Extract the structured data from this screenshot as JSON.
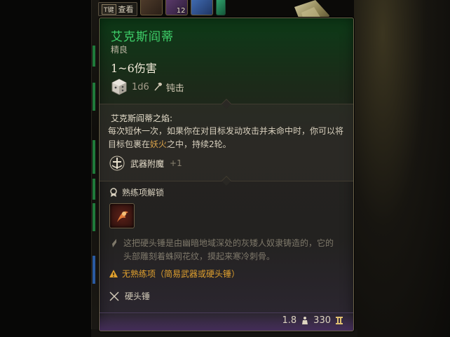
{
  "hotbar": {
    "key": "T键",
    "inspect_label": "查看",
    "slot_count": "12"
  },
  "item": {
    "name": "艾克斯阎蒂",
    "rarity": "精良",
    "damage": "1~6伤害",
    "dice": "1d6",
    "damage_type": "钝击",
    "ability_title": "艾克斯阎蒂之焰:",
    "ability_desc_part1": "每次短休一次，如果你在对目标发动攻击并未命中时，你可以将目标包裹在",
    "ability_desc_highlight": "妖火",
    "ability_desc_part2": "之中，持续2轮。",
    "enchant_label": "武器附魔",
    "enchant_value": "+1",
    "unlock_label": "熟练项解锁",
    "flavor_text": "这把硬头锤是由幽暗地域深处的灰矮人奴隶铸造的，它的头部雕刻着蛛网花纹，摸起来寒冷刺骨。",
    "warning": "无熟练项（简易武器或硬头锤）",
    "weapon_type": "硬头锤",
    "weight": "1.8",
    "value": "330"
  },
  "colors": {
    "name": "#3fd06a",
    "warning": "#e0a02e",
    "highlight": "#d9a24a"
  },
  "icons": {
    "dice": "d6-icon",
    "enchant": "weapon-enchant-icon",
    "unlock": "proficiency-unlock-icon",
    "flavor": "quill-icon",
    "warning": "warning-icon",
    "type": "crossed-weapons-icon",
    "weight": "weight-icon",
    "value": "gold-icon"
  }
}
